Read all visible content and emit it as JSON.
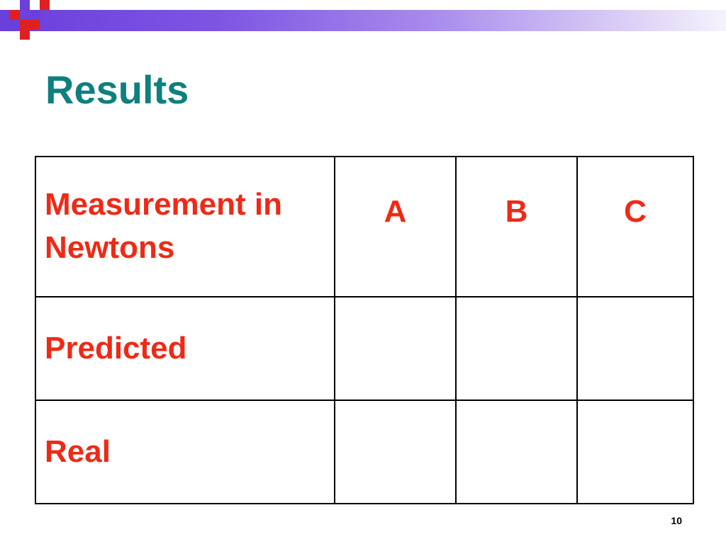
{
  "slide": {
    "title": "Results",
    "page_number": "10"
  },
  "table": {
    "header_label": "Measurement in Newtons",
    "columns": [
      "A",
      "B",
      "C"
    ],
    "rows": [
      {
        "label": "Predicted",
        "values": [
          "",
          "",
          ""
        ]
      },
      {
        "label": "Real",
        "values": [
          "",
          "",
          ""
        ]
      }
    ]
  },
  "theme": {
    "title_color": "#0f7f7f",
    "table_text_color": "#ee2a16",
    "band_color": "#6a3fdc",
    "logo_colors": [
      "#e02020",
      "#6a3fdc"
    ]
  }
}
